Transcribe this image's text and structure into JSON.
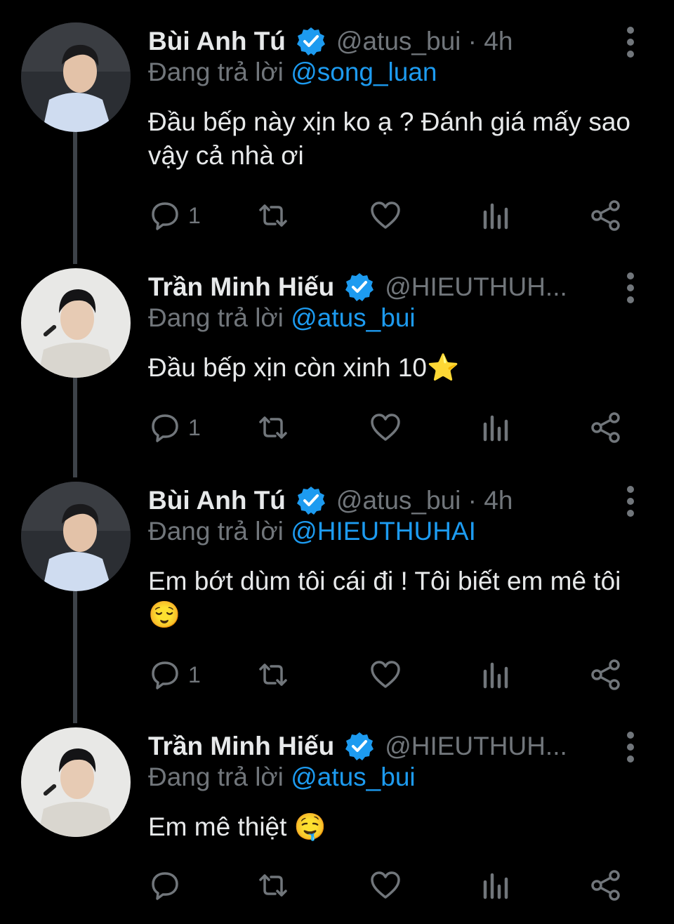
{
  "colors": {
    "background": "#000000",
    "text": "#e7e9ea",
    "muted": "#71767b",
    "accent": "#1d9bf0",
    "thread_line": "#3d4248"
  },
  "tweets": [
    {
      "name": "Bùi Anh Tú",
      "handle": "@atus_bui · 4h",
      "reply_prefix": "Đang trả lời",
      "reply_to": "@song_luan",
      "text": "Đầu bếp này xịn ko ạ ? Đánh giá mấy sao vậy cả nhà ơi",
      "reply_count": "1",
      "avatar_icon": "profile-photo"
    },
    {
      "name": "Trần Minh Hiếu",
      "handle": "@HIEUTHUH...",
      "reply_prefix": "Đang trả lời",
      "reply_to": "@atus_bui",
      "text": "Đầu bếp xịn còn xinh 10⭐",
      "reply_count": "1",
      "avatar_icon": "profile-photo"
    },
    {
      "name": "Bùi Anh Tú",
      "handle": "@atus_bui · 4h",
      "reply_prefix": "Đang trả lời",
      "reply_to": "@HIEUTHUHAI",
      "text": "Em bớt dùm tôi cái đi ! Tôi biết em mê tôi 😌",
      "reply_count": "1",
      "avatar_icon": "profile-photo"
    },
    {
      "name": "Trần Minh Hiếu",
      "handle": "@HIEUTHUH...",
      "reply_prefix": "Đang trả lời",
      "reply_to": "@atus_bui",
      "text": "Em mê thiệt 🤤",
      "reply_count": "",
      "avatar_icon": "profile-photo"
    }
  ],
  "icons": {
    "verified": "verified-badge-icon",
    "more": "more-vertical-icon",
    "reply": "reply-icon",
    "retweet": "retweet-icon",
    "like": "heart-icon",
    "analytics": "analytics-icon",
    "share": "share-icon"
  }
}
